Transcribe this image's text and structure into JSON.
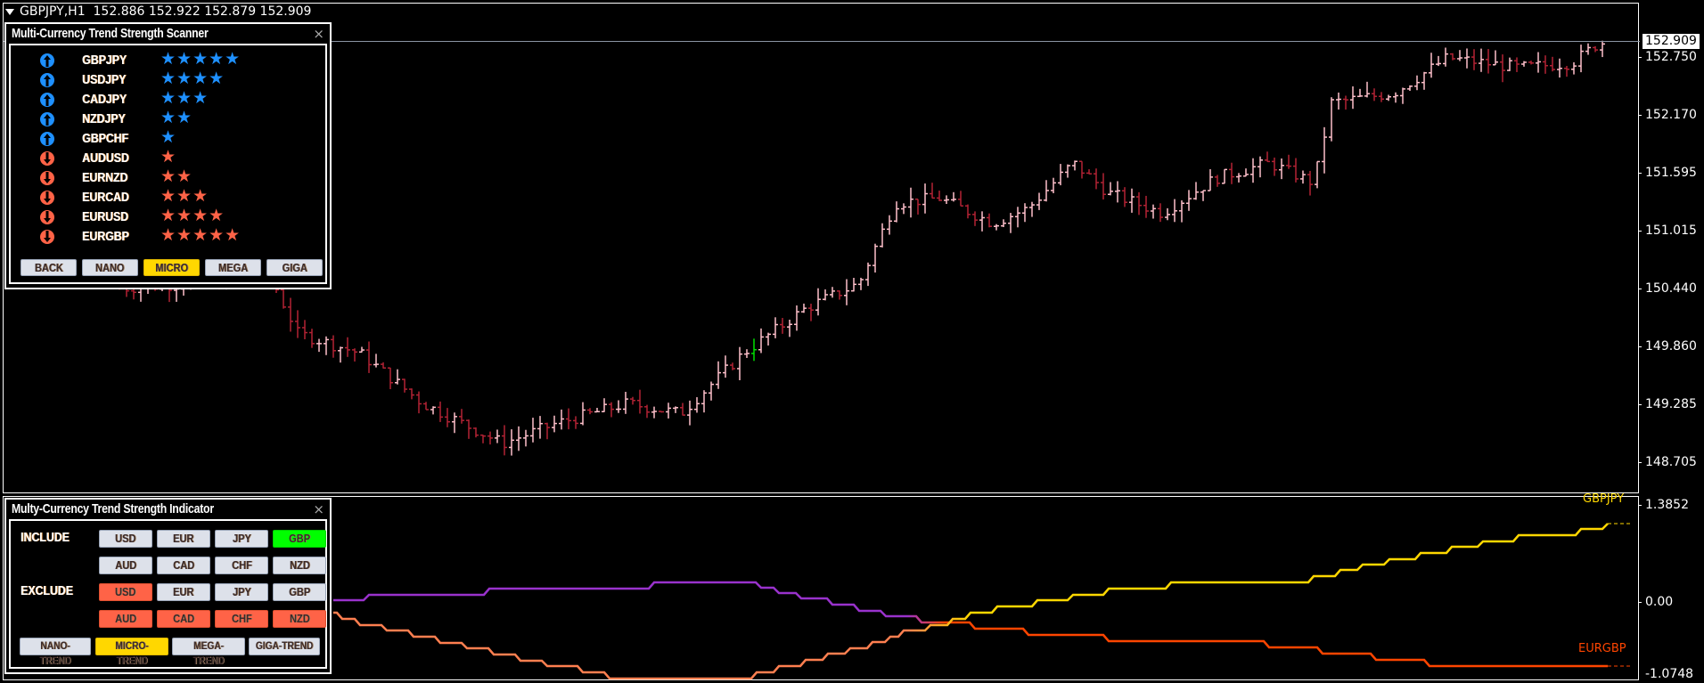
{
  "chart": {
    "symbol_timeframe": "GBPJPY,H1",
    "ohlc_readout": "152.886 152.922 152.879 152.909",
    "current_price": "152.909",
    "price_axis": [
      "152.750",
      "152.170",
      "151.595",
      "151.015",
      "150.440",
      "149.860",
      "149.285",
      "148.705"
    ],
    "colors": {
      "up_bar": "#ffc0cb",
      "down_bar": "#b22234",
      "highlight_bar": "#00e000",
      "current_line": "#8a94a3"
    }
  },
  "indicator_axis": {
    "top": "1.3852",
    "zero": "0.00",
    "bottom": "-1.0748"
  },
  "indicator_series": [
    {
      "name": "GBPJPY",
      "color": "#ffd700"
    },
    {
      "name": "EURGBP",
      "color": "#ff4500"
    }
  ],
  "scanner": {
    "title": "Multi-Currency Trend Strength Scanner",
    "close": "×",
    "rows": [
      {
        "symbol": "GBPJPY",
        "direction": "up",
        "stars": "★★★★★",
        "strength": 5
      },
      {
        "symbol": "USDJPY",
        "direction": "up",
        "stars": "★★★★",
        "strength": 4
      },
      {
        "symbol": "CADJPY",
        "direction": "up",
        "stars": "★★★",
        "strength": 3
      },
      {
        "symbol": "NZDJPY",
        "direction": "up",
        "stars": "★★",
        "strength": 2
      },
      {
        "symbol": "GBPCHF",
        "direction": "up",
        "stars": "★",
        "strength": 1
      },
      {
        "symbol": "AUDUSD",
        "direction": "down",
        "stars": "★",
        "strength": 1
      },
      {
        "symbol": "EURNZD",
        "direction": "down",
        "stars": "★★",
        "strength": 2
      },
      {
        "symbol": "EURCAD",
        "direction": "down",
        "stars": "★★★",
        "strength": 3
      },
      {
        "symbol": "EURUSD",
        "direction": "down",
        "stars": "★★★★",
        "strength": 4
      },
      {
        "symbol": "EURGBP",
        "direction": "down",
        "stars": "★★★★★",
        "strength": 5
      }
    ],
    "buttons": [
      "BACK",
      "NANO",
      "MICRO",
      "MEGA",
      "GIGA"
    ],
    "active_button": "MICRO",
    "colors": {
      "up": "#1e90ff",
      "down": "#ff6347"
    }
  },
  "indicator_panel": {
    "title": "Multy-Currency Trend Strength Indicator",
    "close": "×",
    "include_label": "INCLUDE",
    "exclude_label": "EXCLUDE",
    "include": [
      {
        "label": "USD",
        "active": false
      },
      {
        "label": "EUR",
        "active": false
      },
      {
        "label": "JPY",
        "active": false
      },
      {
        "label": "GBP",
        "active": true
      },
      {
        "label": "AUD",
        "active": false
      },
      {
        "label": "CAD",
        "active": false
      },
      {
        "label": "CHF",
        "active": false
      },
      {
        "label": "NZD",
        "active": false
      }
    ],
    "exclude": [
      {
        "label": "USD",
        "active": true
      },
      {
        "label": "EUR",
        "active": false
      },
      {
        "label": "JPY",
        "active": false
      },
      {
        "label": "GBP",
        "active": false
      },
      {
        "label": "AUD",
        "active": true
      },
      {
        "label": "CAD",
        "active": true
      },
      {
        "label": "CHF",
        "active": true
      },
      {
        "label": "NZD",
        "active": true
      }
    ],
    "trend_buttons": [
      "NANO-TREND",
      "MICRO-TREND",
      "MEGA-TREND",
      "GIGA-TREND"
    ],
    "active_trend": "MICRO-TREND"
  }
}
